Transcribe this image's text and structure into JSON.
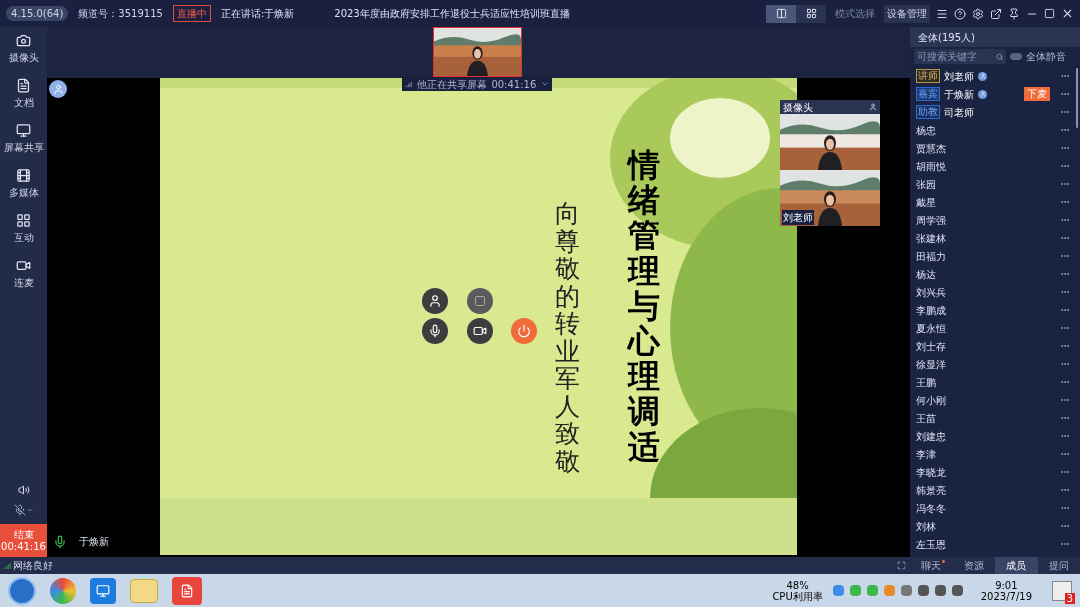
{
  "top_bar": {
    "version": "4.15.0(64)",
    "channel": "频道号：3519115",
    "live_badge": "直播中",
    "speaking": "正在讲话:于焕新",
    "title": "2023年度由政府安排工作退役士兵适应性培训班直播",
    "layout_buttons": [
      {
        "kind": "single",
        "selected": true
      },
      {
        "kind": "grid",
        "selected": false
      }
    ],
    "mode_button": {
      "label": "模式选择",
      "disabled": true
    },
    "device_button": {
      "label": "设备管理",
      "disabled": false
    }
  },
  "sidebar": {
    "tools": [
      {
        "kind": "camera",
        "label": "摄像头"
      },
      {
        "kind": "document",
        "label": "文档"
      },
      {
        "kind": "screen",
        "label": "屏幕共享"
      },
      {
        "kind": "media",
        "label": "多媒体"
      },
      {
        "kind": "interact",
        "label": "互动"
      },
      {
        "kind": "mic",
        "label": "连麦"
      }
    ],
    "end_button": {
      "label": "结束",
      "time": "00:41:16"
    }
  },
  "stage": {
    "thumbnail_label": "他正在共享屏幕",
    "thumbnail_time": "00:41:16",
    "speaker": "于焕新",
    "slide": {
      "title": "情绪管理与心理调适",
      "subtitle": "向尊敬的转业军人致敬"
    },
    "floating_video": {
      "header": "摄像头",
      "caption": "刘老师"
    }
  },
  "members": {
    "header": "全体(195人)",
    "search": {
      "placeholder": "可搜索关键字"
    },
    "mute_all": {
      "label": "全体静音",
      "on": false
    },
    "list": [
      {
        "name": "刘老师",
        "role": "讲师",
        "kind": "lecturer",
        "verified": true
      },
      {
        "name": "于焕新",
        "role": "嘉宾",
        "kind": "guest",
        "verified": true,
        "action": "下麦"
      },
      {
        "name": "司老师",
        "role": "助教",
        "kind": "assistant",
        "verified": false
      },
      {
        "name": "杨忠",
        "kind": "student",
        "verified": false
      },
      {
        "name": "贾慧杰",
        "kind": "student",
        "verified": false
      },
      {
        "name": "胡雨悦",
        "kind": "student",
        "verified": false
      },
      {
        "name": "张园",
        "kind": "student",
        "verified": false
      },
      {
        "name": "戴星",
        "kind": "student",
        "verified": false
      },
      {
        "name": "周学强",
        "kind": "student",
        "verified": false
      },
      {
        "name": "张建林",
        "kind": "student",
        "verified": false
      },
      {
        "name": "田福力",
        "kind": "student",
        "verified": false
      },
      {
        "name": "杨达",
        "kind": "student",
        "verified": false
      },
      {
        "name": "刘兴兵",
        "kind": "student",
        "verified": false
      },
      {
        "name": "李鹏成",
        "kind": "student",
        "verified": false
      },
      {
        "name": "夏永恒",
        "kind": "student",
        "verified": false
      },
      {
        "name": "刘士存",
        "kind": "student",
        "verified": false
      },
      {
        "name": "徐显洋",
        "kind": "student",
        "verified": false
      },
      {
        "name": "王鹏",
        "kind": "student",
        "verified": false
      },
      {
        "name": "何小刚",
        "kind": "student",
        "verified": false
      },
      {
        "name": "王苗",
        "kind": "student",
        "verified": false
      },
      {
        "name": "刘建忠",
        "kind": "student",
        "verified": false
      },
      {
        "name": "李津",
        "kind": "student",
        "verified": false
      },
      {
        "name": "李晓龙",
        "kind": "student",
        "verified": false
      },
      {
        "name": "韩景亮",
        "kind": "student",
        "verified": false
      },
      {
        "name": "冯冬冬",
        "kind": "student",
        "verified": false
      },
      {
        "name": "刘林",
        "kind": "student",
        "verified": false
      },
      {
        "name": "左玉恩",
        "kind": "student",
        "verified": false
      }
    ]
  },
  "status_bar": {
    "network": "网络良好",
    "tabs": [
      {
        "label": "聊天",
        "selected": false,
        "unread": true
      },
      {
        "label": "资源",
        "selected": false,
        "unread": false
      },
      {
        "label": "成员",
        "selected": true,
        "unread": false
      },
      {
        "label": "提问",
        "selected": false,
        "unread": false
      }
    ]
  },
  "taskbar": {
    "cpu": "48%",
    "cpu_label": "CPU利用率",
    "time": "9:01",
    "date": "2023/7/19",
    "notifications": "3"
  }
}
